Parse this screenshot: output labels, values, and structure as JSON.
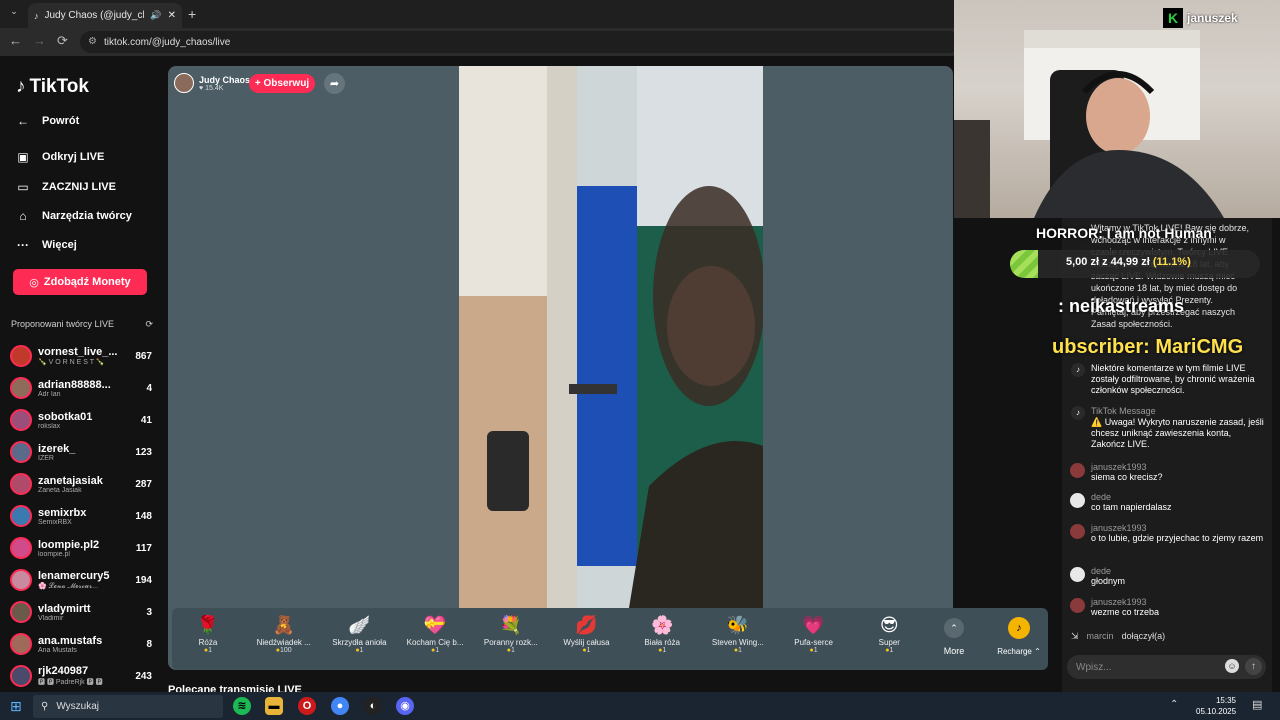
{
  "browser": {
    "tab_title": "Judy Chaos (@judy_chaos) | Tik",
    "url": "tiktok.com/@judy_chaos/live",
    "new_tab": "+",
    "back": "←",
    "forward": "→",
    "reload": "⟳"
  },
  "sidebar": {
    "logo": "TikTok",
    "back": "Powrót",
    "items": [
      {
        "icon": "live-icon",
        "label": "Odkryj LIVE"
      },
      {
        "icon": "camera-icon",
        "label": "ZACZNIJ LIVE"
      },
      {
        "icon": "home-icon",
        "label": "Narzędzia twórcy"
      },
      {
        "icon": "more-icon",
        "label": "Więcej"
      }
    ],
    "coins_button": "Zdobądź Monety",
    "creators_heading": "Proponowani twórcy LIVE",
    "creators": [
      {
        "name": "vornest_live_...",
        "sub": "🍾 V O R N E S T 🍾",
        "count": "867",
        "color": "#c0392b"
      },
      {
        "name": "adrian88888...",
        "sub": "Adr Ian",
        "count": "4",
        "color": "#8e6b5a"
      },
      {
        "name": "sobotka01",
        "sub": "rokslax",
        "count": "41",
        "color": "#9a4f7a"
      },
      {
        "name": "izerek_",
        "sub": "IZER",
        "count": "123",
        "color": "#5a6a8a"
      },
      {
        "name": "zanetajasiak",
        "sub": "Zaneta Jasiak",
        "count": "287",
        "color": "#b04a6a"
      },
      {
        "name": "semixrbx",
        "sub": "SemixRBX",
        "count": "148",
        "color": "#3a7ab0"
      },
      {
        "name": "loompie.pl2",
        "sub": "loompie.pl",
        "count": "117",
        "color": "#d14a8a"
      },
      {
        "name": "lenamercury5",
        "sub": "🌸 𝓛𝓮𝓷𝓪 𝓜𝓮𝓻𝓬𝓾𝓻...",
        "count": "194",
        "color": "#c98aa0"
      },
      {
        "name": "vladymirtt",
        "sub": "Vladimir",
        "count": "3",
        "color": "#6a5a4a"
      },
      {
        "name": "ana.mustafs",
        "sub": "Ana Mustafs",
        "count": "8",
        "color": "#a06a5a"
      },
      {
        "name": "rjk240987",
        "sub": "🅿 🅿 PadreRjk 🅿 🅿",
        "count": "243",
        "color": "#4a4a6a"
      }
    ]
  },
  "stream": {
    "host_name": "Judy Chaos",
    "host_likes": "♥ 15.4K",
    "follow_button": "+ Obserwuj",
    "share_icon": "share-icon",
    "section_title": "Polecane transmisje LIVE"
  },
  "gifts": [
    {
      "icon": "🌹",
      "name": "Róża",
      "price": "1"
    },
    {
      "icon": "🧸",
      "name": "Niedźwiadek ...",
      "price": "100"
    },
    {
      "icon": "🪽",
      "name": "Skrzydła anioła",
      "price": "1"
    },
    {
      "icon": "💝",
      "name": "Kocham Cię b...",
      "price": "1"
    },
    {
      "icon": "💐",
      "name": "Poranny rozk...",
      "price": "1"
    },
    {
      "icon": "💋",
      "name": "Wyślij całusa",
      "price": "1"
    },
    {
      "icon": "🌸",
      "name": "Biała róża",
      "price": "1"
    },
    {
      "icon": "🐝",
      "name": "Steven Wing...",
      "price": "1"
    },
    {
      "icon": "💗",
      "name": "Pufa-serce",
      "price": "1"
    },
    {
      "icon": "😎",
      "name": "Super",
      "price": "1"
    }
  ],
  "gift_more": "More",
  "recharge": "Recharge ⌃",
  "webcam": {
    "brand": "januszek"
  },
  "overlay": {
    "title": "HORROR: I am not Human",
    "goal_current": "5,00 zł",
    "goal_mid": " z 44,99 zł ",
    "goal_pct": "(11.1%)",
    "goal_fraction": 0.111,
    "line1": ": neikastreams",
    "line2": "ubscriber: MariCMG"
  },
  "chat": {
    "welcome": "Witamy w TikTok LIVE! Baw się dobrze, wchodząc w interakcje z innymi w czasie rzeczywistym. Twórcy LIVE muszą mieć ukończone 18 lat, aby zacząć LIVE. Widzowie muszą mieć ukończone 18 lat, by mieć dostęp do doładowań i wysyłać Prezenty. Pamiętaj, aby przestrzegać naszych Zasad społeczności.",
    "filtered": "Niektóre komentarze w tym filmie LIVE zostały odfiltrowane, by chronić wrażenia członków społeczności.",
    "system_user": "TikTok Message",
    "system_text": "⚠️ Uwaga! Wykryto naruszenie zasad, jeśli chcesz uniknąć zawieszenia konta, Zakończ LIVE.",
    "messages": [
      {
        "user": "januszek1993",
        "text": "siema co krecisz?",
        "color": "#8a3a3a"
      },
      {
        "user": "dede",
        "text": "co tam napierdalasz",
        "color": "#e8e8e8"
      },
      {
        "user": "januszek1993",
        "text": "o to lubie, gdzie przyjechac to zjemy razem",
        "color": "#8a3a3a"
      },
      {
        "user": "dede",
        "text": "głodnym",
        "color": "#e8e8e8"
      },
      {
        "user": "januszek1993",
        "text": "wezme co trzeba",
        "color": "#8a3a3a"
      }
    ],
    "joined_user": "marcin",
    "joined_text": "dołączył(a)",
    "input_placeholder": "Wpisz..."
  },
  "taskbar": {
    "search": "Wyszukaj",
    "time": "15:35",
    "date": "05.10.2025"
  }
}
